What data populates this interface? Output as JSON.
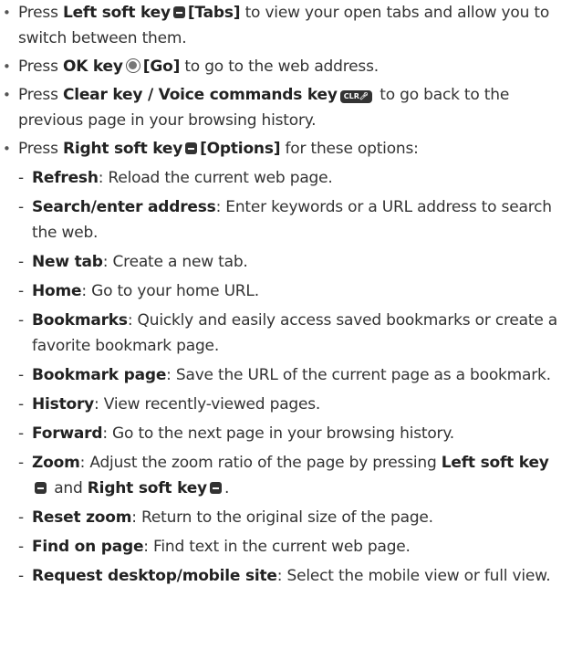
{
  "keys": {
    "left_soft": "Left soft key",
    "right_soft": "Right soft key",
    "ok": "OK key",
    "clear_voice": "Clear key / Voice commands key",
    "clr_icon_text": "CLR"
  },
  "bullets": [
    {
      "pre": "Press ",
      "key": "Left soft key",
      "label": "[Tabs]",
      "post": " to view your open tabs and allow you to switch between them."
    },
    {
      "pre": "Press ",
      "key": "OK key",
      "label": "[Go]",
      "post": " to go to the web address."
    },
    {
      "pre": "Press ",
      "key": "Clear key / Voice commands key",
      "post": " to go back to the previous page in your browsing history."
    },
    {
      "pre": "Press ",
      "key": "Right soft key",
      "label": "[Options]",
      "post": " for these options:"
    }
  ],
  "options": [
    {
      "term": "Refresh",
      "desc": ": Reload the current web page."
    },
    {
      "term": "Search/enter address",
      "desc": ": Enter keywords or a URL address to search the web."
    },
    {
      "term": "New tab",
      "desc": ": Create a new tab."
    },
    {
      "term": "Home",
      "desc": ": Go to your home URL."
    },
    {
      "term": "Bookmarks",
      "desc": ": Quickly and easily access saved bookmarks or create a favorite bookmark page."
    },
    {
      "term": "Bookmark page",
      "desc": ": Save the URL of the current page as a bookmark."
    },
    {
      "term": "History",
      "desc": ": View recently-viewed pages."
    },
    {
      "term": "Forward",
      "desc": ": Go to the next page in your browsing history."
    },
    {
      "term": "Zoom",
      "desc": ": Adjust the zoom ratio of the page by pressing ",
      "key1": "Left soft key",
      "mid": " and ",
      "key2": "Right soft key",
      "end": "."
    },
    {
      "term": "Reset zoom",
      "desc": ": Return to the original size of the page."
    },
    {
      "term": "Find on page",
      "desc": ": Find text in the current web page."
    },
    {
      "term": "Request desktop/mobile site",
      "desc": ": Select the mobile view or full view."
    }
  ]
}
